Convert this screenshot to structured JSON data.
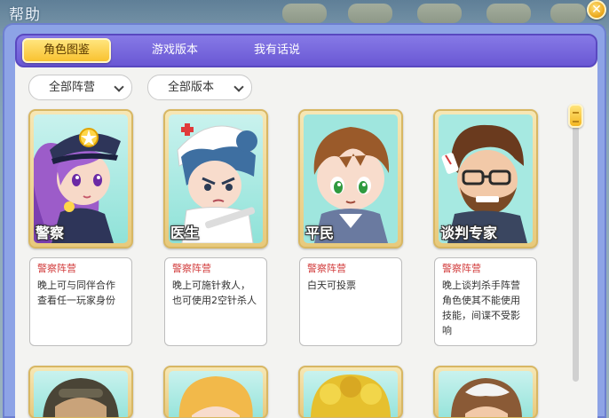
{
  "window": {
    "title": "帮助"
  },
  "tabs": [
    {
      "label": "角色图鉴",
      "active": true
    },
    {
      "label": "游戏版本",
      "active": false
    },
    {
      "label": "我有话说",
      "active": false
    }
  ],
  "filters": {
    "camp": "全部阵营",
    "version": "全部版本"
  },
  "cards": [
    {
      "name": "警察",
      "camp": "警察阵营",
      "desc": "晚上可与同伴合作查看任一玩家身份"
    },
    {
      "name": "医生",
      "camp": "警察阵营",
      "desc": "晚上可施针救人，也可使用2空针杀人"
    },
    {
      "name": "平民",
      "camp": "警察阵营",
      "desc": "白天可投票"
    },
    {
      "name": "谈判专家",
      "camp": "警察阵营",
      "desc": "晚上谈判杀手阵营角色使其不能使用技能，间谍不受影响"
    }
  ],
  "colors": {
    "accent": "#6a58d4",
    "active_tab": "#f9c230",
    "camp_text": "#d23c3c"
  }
}
